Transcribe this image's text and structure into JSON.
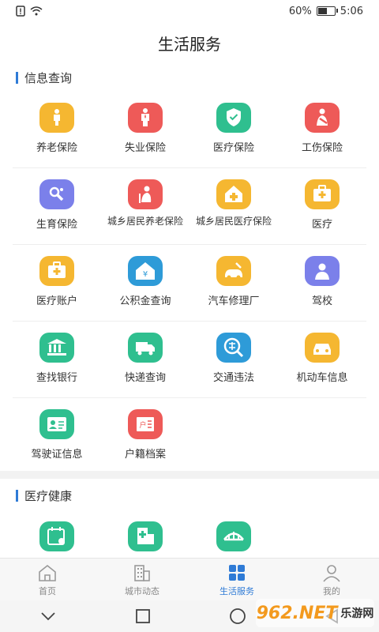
{
  "status": {
    "battery": "60%",
    "time": "5:06",
    "battery_level": 0.6
  },
  "header": {
    "title": "生活服务"
  },
  "sections": [
    {
      "title": "信息查询"
    },
    {
      "title": "医疗健康"
    }
  ],
  "info_items": [
    {
      "label": "养老保险",
      "color": "#f5b731",
      "icon": "elderly-icon"
    },
    {
      "label": "失业保险",
      "color": "#ee5a58",
      "icon": "unemployed-icon"
    },
    {
      "label": "医疗保险",
      "color": "#2fbf8f",
      "icon": "shield-icon"
    },
    {
      "label": "工伤保险",
      "color": "#ee5a58",
      "icon": "injury-icon"
    },
    {
      "label": "生育保险",
      "color": "#7b80ea",
      "icon": "pacifier-icon"
    },
    {
      "label": "城乡居民养老保险",
      "color": "#ee5a58",
      "icon": "elder-person-icon"
    },
    {
      "label": "城乡居民医疗保险",
      "color": "#f5b731",
      "icon": "hospital-house-icon"
    },
    {
      "label": "医疗",
      "color": "#f5b731",
      "icon": "medical-kit-icon"
    },
    {
      "label": "医疗账户",
      "color": "#f5b731",
      "icon": "medical-kit-icon"
    },
    {
      "label": "公积金查询",
      "color": "#2e9bd8",
      "icon": "yuan-house-icon"
    },
    {
      "label": "汽车修理厂",
      "color": "#f5b731",
      "icon": "car-repair-icon"
    },
    {
      "label": "驾校",
      "color": "#7b80ea",
      "icon": "driver-icon"
    },
    {
      "label": "查找银行",
      "color": "#2fbf8f",
      "icon": "bank-icon"
    },
    {
      "label": "快递查询",
      "color": "#2fbf8f",
      "icon": "truck-icon"
    },
    {
      "label": "交通违法",
      "color": "#2e9bd8",
      "icon": "violation-icon"
    },
    {
      "label": "机动车信息",
      "color": "#f5b731",
      "icon": "car-icon"
    },
    {
      "label": "驾驶证信息",
      "color": "#2fbf8f",
      "icon": "id-card-icon"
    },
    {
      "label": "户籍档案",
      "color": "#ee5a58",
      "icon": "household-icon"
    }
  ],
  "health_items": [
    {
      "color": "#2fbf8f",
      "icon": "appointment-icon"
    },
    {
      "color": "#2fbf8f",
      "icon": "hospital-building-icon"
    },
    {
      "color": "#2fbf8f",
      "icon": "bridge-icon"
    }
  ],
  "tabs": [
    {
      "label": "首页",
      "icon": "home-icon"
    },
    {
      "label": "城市动态",
      "icon": "city-icon"
    },
    {
      "label": "生活服务",
      "icon": "grid-icon",
      "active": true
    },
    {
      "label": "我的",
      "icon": "user-icon"
    }
  ],
  "accent": "#2f7bd6",
  "watermark": {
    "text": "962.NET",
    "subtext": "乐游网"
  }
}
